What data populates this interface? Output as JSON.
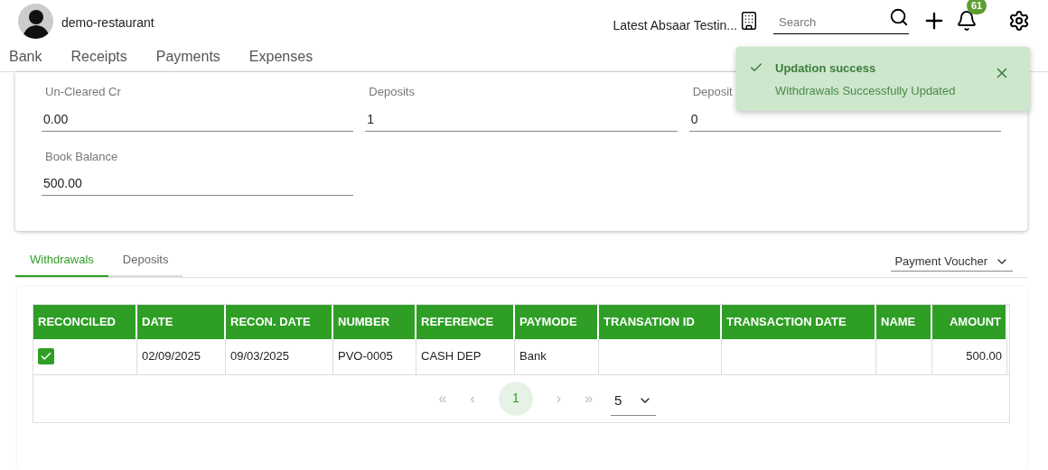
{
  "header": {
    "user": "demo-restaurant",
    "company": "Latest Absaar Testin...",
    "search": {
      "placeholder": "Search"
    },
    "notifications": "61"
  },
  "nav": [
    {
      "label": "Bank",
      "selected": false
    },
    {
      "label": "Receipts",
      "selected": false
    },
    {
      "label": "Payments",
      "selected": false
    },
    {
      "label": "Expenses",
      "selected": false
    }
  ],
  "fields": [
    {
      "label": "Un-Cleared Cr",
      "value": "0.00"
    },
    {
      "label": "Deposits",
      "value": "1"
    },
    {
      "label": "Deposit",
      "value": "0"
    },
    {
      "label": "Book Balance",
      "value": "500.00"
    }
  ],
  "tabs": [
    {
      "label": "Withdrawals",
      "selected": true
    },
    {
      "label": "Deposits",
      "selected": false
    }
  ],
  "voucher_select": "Payment Voucher",
  "table": {
    "columns": [
      "RECONCILED",
      "DATE",
      "RECON. DATE",
      "NUMBER",
      "REFERENCE",
      "PAYMODE",
      "TRANSATION ID",
      "TRANSACTION DATE",
      "NAME",
      "AMOUNT"
    ],
    "rows": [
      {
        "checked": true,
        "cells": [
          "",
          "02/09/2025",
          "09/03/2025",
          "PVO-0005",
          "CASH DEP",
          "Bank",
          "",
          "",
          "",
          "500.00"
        ]
      }
    ]
  },
  "pagination": {
    "first": "«",
    "prev": "‹",
    "pages": [
      {
        "label": "1",
        "selected": true
      }
    ],
    "next": "›",
    "last": "»",
    "page_size": "5"
  },
  "toast": {
    "title": "Updation success",
    "message": "Withdrawals Successfully Updated"
  }
}
